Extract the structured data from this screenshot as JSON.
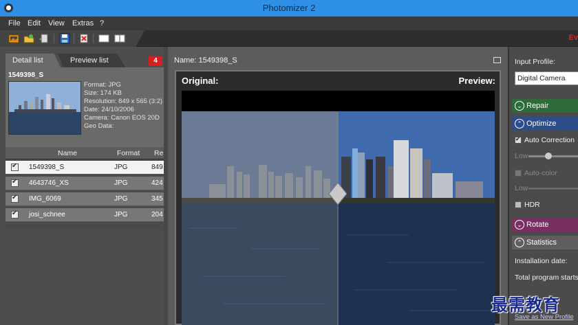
{
  "window": {
    "title": "Photomizer 2"
  },
  "menu": [
    "File",
    "Edit",
    "View",
    "Extras",
    "?"
  ],
  "toolbar": {
    "brand": "Ev"
  },
  "left": {
    "tabs": [
      "Detail list",
      "Preview list"
    ],
    "badge": "4",
    "detail": {
      "filename": "1549398_S",
      "format": "Format: JPG",
      "size": "Size: 174 KB",
      "resolution": "Resolution: 849 x 565 (3:2)",
      "date": "Date: 24/10/2006",
      "camera": "Camera: Canon EOS 20D",
      "geo": "Geo Data:"
    },
    "columns": [
      "Name",
      "Format",
      "Re"
    ],
    "rows": [
      {
        "name": "1549398_S",
        "format": "JPG",
        "res": "849"
      },
      {
        "name": "4643746_XS",
        "format": "JPG",
        "res": "424"
      },
      {
        "name": "IMG_6069",
        "format": "JPG",
        "res": "345"
      },
      {
        "name": "josi_schnee",
        "format": "JPG",
        "res": "204"
      }
    ]
  },
  "center": {
    "name_label": "Name: 1549398_S",
    "original": "Original:",
    "preview": "Preview:"
  },
  "right": {
    "input_profile_label": "Input Profile:",
    "input_profile_value": "Digital Camera",
    "repair": "Repair",
    "optimize": "Optimize",
    "auto_correction": "Auto Correction",
    "low1": "Low",
    "auto_color": "Auto-color",
    "low2": "Low",
    "hdr": "HDR",
    "rotate": "Rotate",
    "statistics": "Statistics",
    "installation_date": "Installation date:",
    "total_program": "Total program starts",
    "save_profile": "Save as New Profile"
  },
  "watermark": "最需教育",
  "colors": {
    "titlebar": "#2d8fe6",
    "repair": "#2f6b3a",
    "optimize": "#2d4d8a",
    "rotate": "#7a2e62",
    "badge": "#d42020"
  }
}
